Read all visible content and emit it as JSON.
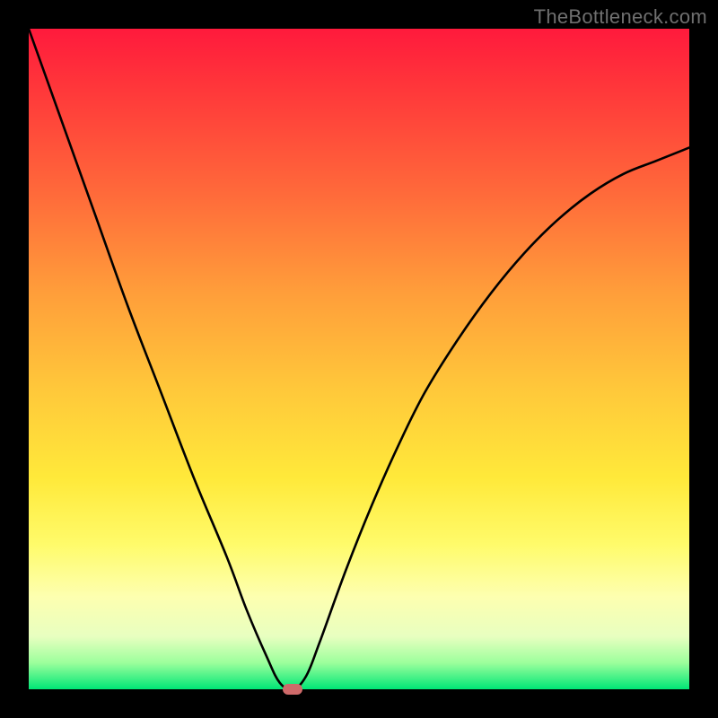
{
  "watermark": "TheBottleneck.com",
  "chart_data": {
    "type": "line",
    "title": "",
    "xlabel": "",
    "ylabel": "",
    "xlim": [
      0,
      100
    ],
    "ylim": [
      0,
      100
    ],
    "grid": false,
    "legend": false,
    "series": [
      {
        "name": "bottleneck-curve",
        "x": [
          0,
          5,
          10,
          15,
          20,
          25,
          30,
          33,
          36,
          38,
          40,
          42,
          44,
          48,
          52,
          56,
          60,
          65,
          70,
          75,
          80,
          85,
          90,
          95,
          100
        ],
        "y": [
          100,
          86,
          72,
          58,
          45,
          32,
          20,
          12,
          5,
          1,
          0,
          2,
          7,
          18,
          28,
          37,
          45,
          53,
          60,
          66,
          71,
          75,
          78,
          80,
          82
        ]
      }
    ],
    "marker": {
      "x": 40,
      "y": 0
    },
    "gradient_stops": [
      {
        "pos": 0.0,
        "color": "#ff1a3c"
      },
      {
        "pos": 0.1,
        "color": "#ff3a3a"
      },
      {
        "pos": 0.25,
        "color": "#ff6a3a"
      },
      {
        "pos": 0.4,
        "color": "#ff9e3a"
      },
      {
        "pos": 0.55,
        "color": "#ffc93a"
      },
      {
        "pos": 0.68,
        "color": "#ffe93a"
      },
      {
        "pos": 0.78,
        "color": "#fffb6a"
      },
      {
        "pos": 0.86,
        "color": "#fdffb0"
      },
      {
        "pos": 0.92,
        "color": "#e8ffc0"
      },
      {
        "pos": 0.96,
        "color": "#9cff9c"
      },
      {
        "pos": 1.0,
        "color": "#00e676"
      }
    ]
  }
}
